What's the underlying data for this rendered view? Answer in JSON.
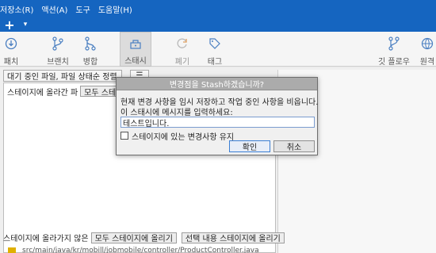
{
  "menu": [
    "저장소(R)",
    "액션(A)",
    "도구",
    "도움말(H)"
  ],
  "tabs": {
    "new_tab": "+",
    "caret": "▾"
  },
  "toolbar": {
    "items": [
      {
        "label": "패치",
        "icon": "patch-icon"
      },
      {
        "label": "브랜치",
        "icon": "branch-icon"
      },
      {
        "label": "병합",
        "icon": "merge-icon"
      },
      {
        "label": "스태시",
        "icon": "stash-icon"
      },
      {
        "label": "폐기",
        "icon": "discard-icon"
      },
      {
        "label": "태그",
        "icon": "tag-icon"
      },
      {
        "label": "깃 플로우",
        "icon": "git-flow-icon"
      },
      {
        "label": "원격",
        "icon": "remote-icon"
      }
    ]
  },
  "filter": {
    "value": "대기 중인 파일, 파일 상태순 정렬"
  },
  "staged": {
    "label": "스테이지에 올라간 파",
    "button": "모두 스테이"
  },
  "unstaged": {
    "label": "스테이지에 올라가지 않은",
    "stage_all": "모두 스테이지에 올리기",
    "stage_selected": "선택 내용 스테이지에 올리기"
  },
  "file": {
    "path": "src/main/java/kr/mobill/jobmobile/controller/ProductController.java"
  },
  "dialog": {
    "title": "변경점을 Stash하겠습니까?",
    "line1": "현재 변경 사항을 임시 저장하고 작업 중인 사항을 비웁니다.",
    "line2": "이 스태시에 메시지를 입력하세요:",
    "input_value": "테스트입니다.",
    "keep_staged": "스테이지에 있는 변경사항 유지",
    "ok": "확인",
    "cancel": "취소"
  },
  "colors": {
    "brand": "#1565c0",
    "dialog_title": "#ababab"
  }
}
